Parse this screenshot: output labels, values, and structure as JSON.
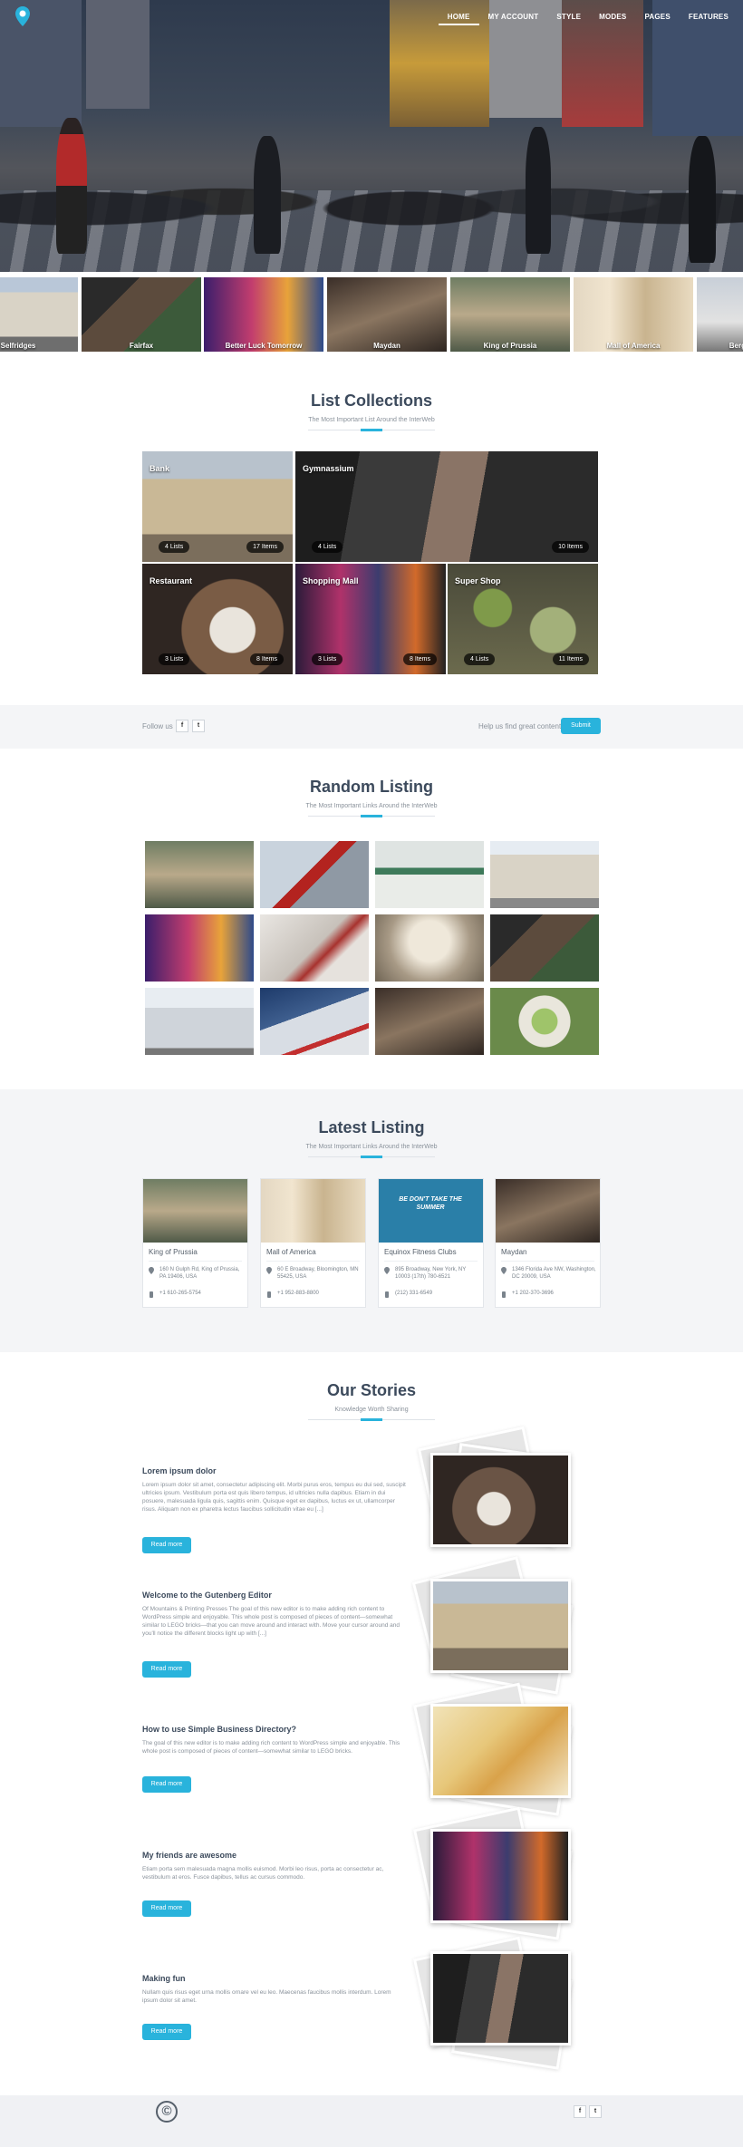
{
  "nav": {
    "items": [
      "HOME",
      "MY ACCOUNT",
      "STYLE",
      "MODES",
      "PAGES",
      "FEATURES"
    ]
  },
  "strip": {
    "items": [
      "Selfridges",
      "Fairfax",
      "Better Luck Tomorrow",
      "Maydan",
      "King of Prussia",
      "Mall of America",
      "Berg"
    ]
  },
  "collections": {
    "title": "List Collections",
    "subtitle": "The Most Important List Around the InterWeb",
    "items": [
      {
        "name": "Bank",
        "lists": "4 Lists",
        "items": "17 Items"
      },
      {
        "name": "Gymnassium",
        "lists": "4 Lists",
        "items": "10 Items"
      },
      {
        "name": "Restaurant",
        "lists": "3 Lists",
        "items": "8 Items"
      },
      {
        "name": "Shopping Mall",
        "lists": "3 Lists",
        "items": "8 Items"
      },
      {
        "name": "Super Shop",
        "lists": "4 Lists",
        "items": "11 Items"
      }
    ]
  },
  "follow": {
    "label": "Follow us",
    "facebook": "f",
    "twitter": "t",
    "help": "Help us find great content",
    "submit": "Submit"
  },
  "random": {
    "title": "Random Listing",
    "subtitle": "The Most Important Links Around the InterWeb"
  },
  "latest": {
    "title": "Latest Listing",
    "subtitle": "The Most Important Links Around the InterWeb",
    "cards": [
      {
        "title": "King of Prussia",
        "address": "160 N Gulph Rd, King of Prussia, PA 19406, USA",
        "phone": "+1 610-265-5754"
      },
      {
        "title": "Mall of America",
        "address": "60 E Broadway, Bloomington, MN 55425, USA",
        "phone": "+1 952-883-8800"
      },
      {
        "title": "Equinox Fitness Clubs",
        "address": "895 Broadway, New York, NY 10003 (17th) 780-6521",
        "phone": "(212) 331-6549"
      },
      {
        "title": "Maydan",
        "address": "1346 Florida Ave NW, Washington, DC 20009, USA",
        "phone": "+1 202-370-3696"
      }
    ],
    "poster_text": "BE DON'T TAKE THE SUMMER"
  },
  "stories": {
    "title": "Our Stories",
    "subtitle": "Knowledge Worth Sharing",
    "read_more": "Read more",
    "items": [
      {
        "title": "Lorem ipsum dolor",
        "text": "Lorem ipsum dolor sit amet, consectetur adipiscing elit. Morbi purus eros, tempus eu dui sed, suscipit ultricies ipsum. Vestibulum porta est quis libero tempus, id ultricies nulla dapibus. Etiam in dui posuere, malesuada ligula quis, sagittis enim. Quisque eget ex dapibus, luctus ex ut, ullamcorper risus. Aliquam non ex pharetra lectus faucibus sollicitudin vitae eu [...]"
      },
      {
        "title": "Welcome to the Gutenberg Editor",
        "text": "Of Mountains & Printing Presses The goal of this new editor is to make adding rich content to WordPress simple and enjoyable. This whole post is composed of pieces of content—somewhat similar to LEGO bricks—that you can move around and interact with. Move your cursor around and you'll notice the different blocks light up with [...]"
      },
      {
        "title": "How to use Simple Business Directory?",
        "text": "The goal of this new editor is to make adding rich content to WordPress simple and enjoyable. This whole post is composed of pieces of content—somewhat similar to LEGO bricks."
      },
      {
        "title": "My friends are awesome",
        "text": "Etiam porta sem malesuada magna mollis euismod. Morbi leo risus, porta ac consectetur ac, vestibulum at eros. Fusce dapibus, tellus ac cursus commodo."
      },
      {
        "title": "Making fun",
        "text": "Nullam quis risus eget urna mollis ornare vel eu leo. Maecenas faucibus mollis interdum. Lorem ipsum dolor sit amet."
      }
    ]
  },
  "footer": {
    "copyright_icon": "©",
    "facebook": "f",
    "twitter": "t"
  },
  "colors": {
    "accent": "#29b3dc",
    "heading": "#3c4a5c",
    "band": "#f4f5f7"
  }
}
